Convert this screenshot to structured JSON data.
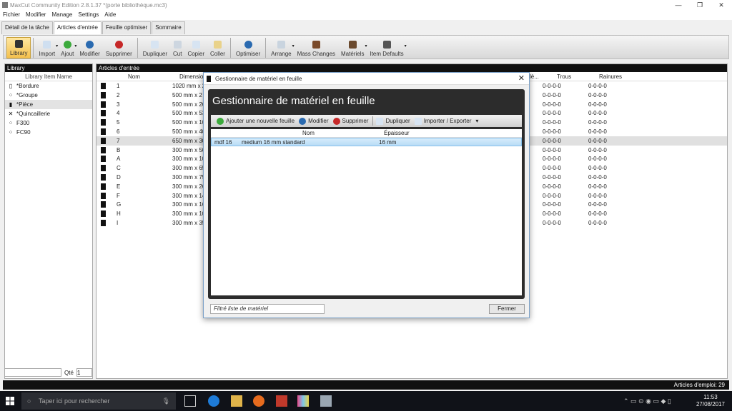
{
  "window": {
    "title": "MaxCut Community Edition 2.8.1.37 *(porte bibliothèque.mc3)",
    "minimize": "—",
    "maximize": "❐",
    "close": "✕"
  },
  "menu": [
    "Fichier",
    "Modifier",
    "Manage",
    "Settings",
    "Aide"
  ],
  "tabs": [
    "Détail de la tâche",
    "Articles d'entrée",
    "Feuille optimiser",
    "Sommaire"
  ],
  "toolbar": [
    "Library",
    "Import",
    "Ajout",
    "Modifier",
    "Supprimer",
    "Dupliquer",
    "Cut",
    "Copier",
    "Coller",
    "Optimiser",
    "Arrange",
    "Mass Changes",
    "Matériels",
    "Item Defaults"
  ],
  "library": {
    "header": "Library",
    "column": "Library Item Name",
    "items": [
      "*Bordure",
      "*Groupe",
      "*Pièce",
      "*Quincaillerie",
      "F300",
      "FC90"
    ],
    "qty_label": "Qté",
    "qty_value": "1"
  },
  "articles": {
    "header": "Articles d'entrée",
    "columns": {
      "nom": "Nom",
      "dimensions": "Dimensio",
      "cut": "lè...",
      "trous": "Trous",
      "rainures": "Rainures"
    },
    "rows": [
      {
        "nom": "1",
        "dim": "1020 mm x 2",
        "trous": "0-0-0-0",
        "rain": "0-0-0-0"
      },
      {
        "nom": "2",
        "dim": "500 mm x 2",
        "trous": "0-0-0-0",
        "rain": "0-0-0-0"
      },
      {
        "nom": "3",
        "dim": "500 mm x 26",
        "trous": "0-0-0-0",
        "rain": "0-0-0-0"
      },
      {
        "nom": "4",
        "dim": "500 mm x 53",
        "trous": "0-0-0-0",
        "rain": "0-0-0-0"
      },
      {
        "nom": "5",
        "dim": "500 mm x 10",
        "trous": "0-0-0-0",
        "rain": "0-0-0-0"
      },
      {
        "nom": "6",
        "dim": "500 mm x 40",
        "trous": "0-0-0-0",
        "rain": "0-0-0-0"
      },
      {
        "nom": "7",
        "dim": "650 mm x 30",
        "trous": "0-0-0-0",
        "rain": "0-0-0-0"
      },
      {
        "nom": "B",
        "dim": "300 mm x 50",
        "trous": "0-0-0-0",
        "rain": "0-0-0-0"
      },
      {
        "nom": "A",
        "dim": "300 mm x 10",
        "trous": "0-0-0-0",
        "rain": "0-0-0-0"
      },
      {
        "nom": "C",
        "dim": "300 mm x 65",
        "trous": "0-0-0-0",
        "rain": "0-0-0-0"
      },
      {
        "nom": "D",
        "dim": "300 mm x 75",
        "trous": "0-0-0-0",
        "rain": "0-0-0-0"
      },
      {
        "nom": "E",
        "dim": "300 mm x 26",
        "trous": "0-0-0-0",
        "rain": "0-0-0-0"
      },
      {
        "nom": "F",
        "dim": "300 mm x 14",
        "trous": "0-0-0-0",
        "rain": "0-0-0-0"
      },
      {
        "nom": "G",
        "dim": "300 mm x 16",
        "trous": "0-0-0-0",
        "rain": "0-0-0-0"
      },
      {
        "nom": "H",
        "dim": "300 mm x 10",
        "trous": "0-0-0-0",
        "rain": "0-0-0-0"
      },
      {
        "nom": "I",
        "dim": "300 mm x 35",
        "trous": "0-0-0-0",
        "rain": "0-0-0-0"
      }
    ]
  },
  "status": {
    "text": "Articles d'emploi: 29"
  },
  "dialog": {
    "title": "Gestionnaire de matériel en feuille",
    "heading": "Gestionnaire de matériel en feuille",
    "buttons": [
      "Ajouter une nouvelle feuille",
      "Modifier",
      "Supprimer",
      "Dupliquer",
      "Importer / Exporter"
    ],
    "columns": {
      "nom": "Nom",
      "epaisseur": "Épaisseur"
    },
    "row": {
      "code": "mdf 16",
      "nom": "medium 16 mm standard",
      "epaisseur": "16 mm"
    },
    "filter_placeholder": "Filtré liste de matériel",
    "close_label": "Fermer",
    "close_icon": "✕"
  },
  "taskbar": {
    "search": "Taper ici pour rechercher",
    "time": "11:53",
    "date": "27/08/2017"
  },
  "colors": {
    "accent": "#f4c04d",
    "dark": "#2c2c2c",
    "selection": "#b8dcf6"
  }
}
